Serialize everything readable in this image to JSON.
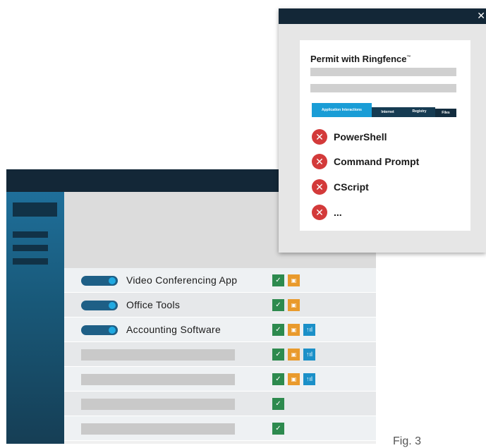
{
  "app": {
    "rows": [
      {
        "label": "Video Conferencing App",
        "toggle": "on",
        "icons": [
          "check-icon",
          "scan-icon"
        ]
      },
      {
        "label": "Office Tools",
        "toggle": "on",
        "icons": [
          "check-icon",
          "scan-icon"
        ]
      },
      {
        "label": "Accounting Software",
        "toggle": "on",
        "icons": [
          "check-icon",
          "scan-icon",
          "network-icon"
        ]
      },
      {
        "label": "",
        "toggle": null,
        "icons": [
          "check-icon",
          "scan-icon",
          "network-icon"
        ]
      },
      {
        "label": "",
        "toggle": null,
        "icons": [
          "check-icon",
          "scan-icon",
          "network-icon"
        ]
      },
      {
        "label": "",
        "toggle": null,
        "icons": [
          "check-icon"
        ]
      },
      {
        "label": "",
        "toggle": null,
        "icons": [
          "check-icon"
        ]
      }
    ]
  },
  "dialog": {
    "close_glyph": "✕",
    "title": "Permit with Ringfence",
    "title_mark": "™",
    "tabs": [
      "Application Interactions",
      "Internet",
      "Registry",
      "Files"
    ],
    "blocked_items": [
      "PowerShell",
      "Command Prompt",
      "CScript",
      "..."
    ]
  },
  "caption": "Fig. 3",
  "colors": {
    "titlebar": "#132737",
    "accent_blue": "#1a9dd6",
    "check_green": "#2d8a4e",
    "scan_orange": "#e99a2c",
    "deny_red": "#d33a3a"
  }
}
